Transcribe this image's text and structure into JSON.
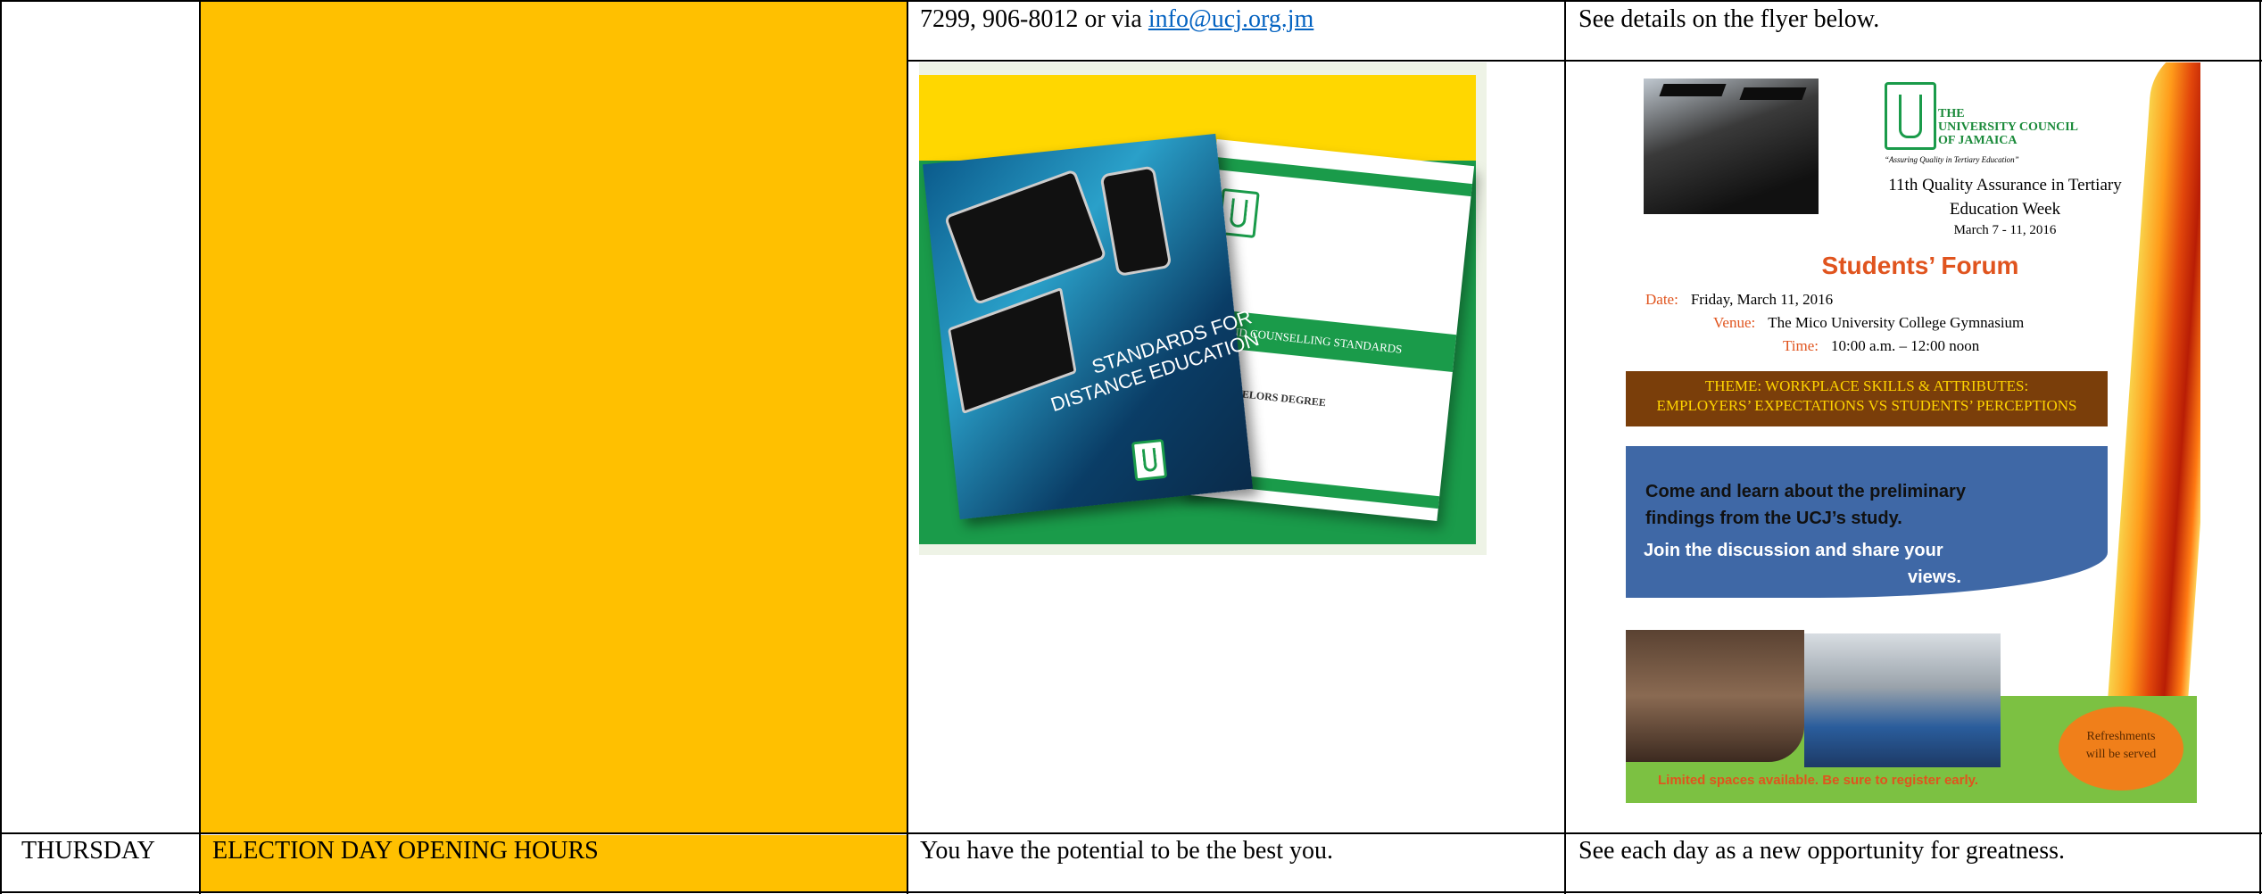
{
  "table": {
    "row1": {
      "contact_prefix": "7299, 906-8012 or via ",
      "email": "info@ucj.org.jm",
      "flyer_note": "See details on the flyer below."
    },
    "row2": {
      "day": "THURSDAY",
      "event": "ELECTION DAY OPENING HOURS",
      "quote1": "You have the potential to be the best you.",
      "quote2": "See each day as a new opportunity for greatness."
    }
  },
  "book_image": {
    "cover_title": "STANDARDS FOR DISTANCE EDUCATION",
    "cover_title_line1": "STANDARDS FOR",
    "cover_title_line2": "DISTANCE EDUCATION",
    "second_cover_band1": "E AND COUNSELLING STANDARDS",
    "second_cover_band2": "CHELORS DEGREE"
  },
  "flyer": {
    "org_line1": "THE",
    "org_line2": "UNIVERSITY COUNCIL",
    "org_line3": "OF JAMAICA",
    "tagline": "“Assuring Quality in Tertiary Education”",
    "qa_week_line1": "11th Quality Assurance in Tertiary",
    "qa_week_line2": "Education Week",
    "week_dates": "March 7 - 11, 2016",
    "forum_title": "Students’ Forum",
    "date_label": "Date:",
    "date_value": "Friday, March 11, 2016",
    "venue_label": "Venue:",
    "venue_value": "The Mico University College Gymnasium",
    "time_label": "Time:",
    "time_value": "10:00 a.m. – 12:00 noon",
    "theme_line1": "THEME: WORKPLACE SKILLS & ATTRIBUTES:",
    "theme_line2": "EMPLOYERS’ EXPECTATIONS VS STUDENTS’ PERCEPTIONS",
    "learn_line1": "Come and learn about the preliminary",
    "learn_line2": "findings from the UCJ’s study.",
    "join_line1": "Join the discussion and share your",
    "join_line2": "views.",
    "limited": "Limited spaces available. Be sure to register early.",
    "refresh_line1": "Refreshments",
    "refresh_line2": "will be served"
  },
  "colors": {
    "highlight": "#FFC000",
    "link": "#0563C1",
    "accent_orange": "#E0541E",
    "ucj_green": "#1a8a3a"
  }
}
